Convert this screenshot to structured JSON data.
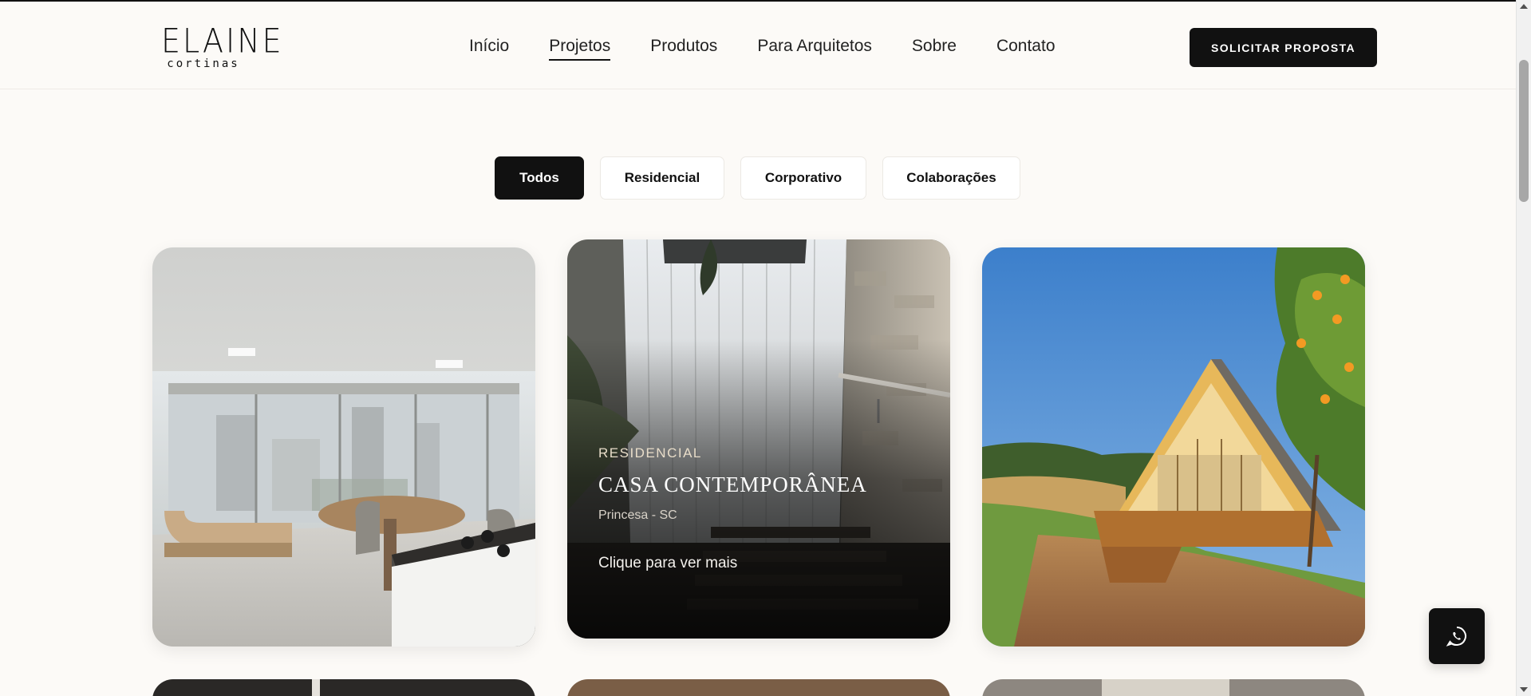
{
  "header": {
    "logo": {
      "main": "ELAINE",
      "sub": "cortinas"
    },
    "nav": [
      {
        "label": "Início",
        "active": false
      },
      {
        "label": "Projetos",
        "active": true
      },
      {
        "label": "Produtos",
        "active": false
      },
      {
        "label": "Para Arquitetos",
        "active": false
      },
      {
        "label": "Sobre",
        "active": false
      },
      {
        "label": "Contato",
        "active": false
      }
    ],
    "cta_label": "SOLICITAR PROPOSTA"
  },
  "filters": [
    {
      "label": "Todos",
      "active": true
    },
    {
      "label": "Residencial",
      "active": false
    },
    {
      "label": "Corporativo",
      "active": false
    },
    {
      "label": "Colaborações",
      "active": false
    }
  ],
  "projects": [
    {
      "image": "apartment-kitchen-with-roller-blinds"
    },
    {
      "image": "staircase-with-sheer-curtains",
      "category": "RESIDENCIAL",
      "title": "CASA CONTEMPORÂNEA",
      "location": "Princesa - SC",
      "cta": "Clique para ver mais"
    },
    {
      "image": "a-frame-cabin-in-countryside"
    }
  ],
  "whatsapp": {
    "icon": "whatsapp-icon"
  },
  "colors": {
    "primary": "#111111",
    "background": "#fcfaf7",
    "accent_text": "#e8ddc9"
  }
}
